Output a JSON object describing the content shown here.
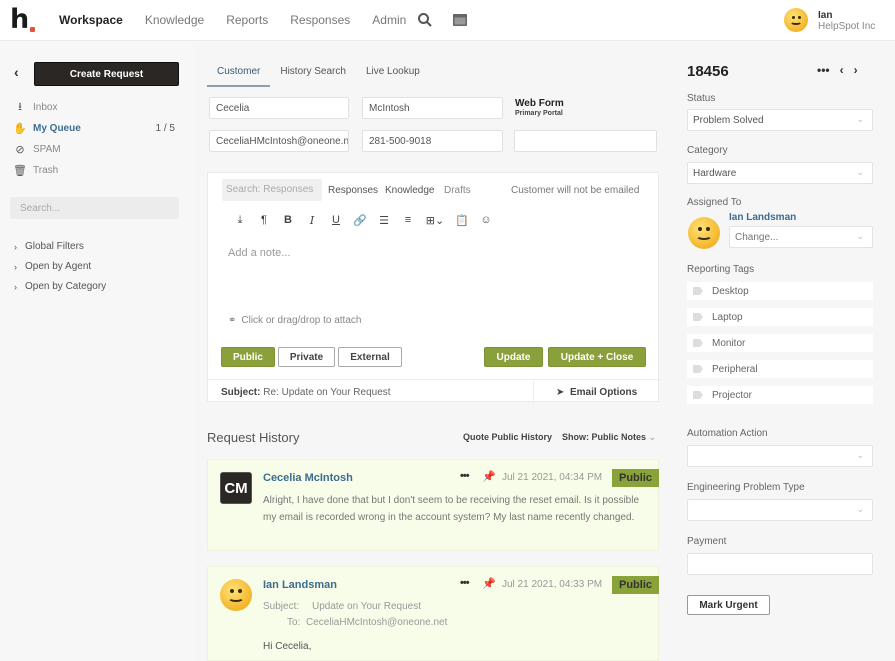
{
  "topbar": {
    "logo": "h",
    "nav": [
      "Workspace",
      "Knowledge",
      "Reports",
      "Responses",
      "Admin"
    ],
    "active_nav": "Workspace",
    "icons": [
      "search-icon",
      "window-icon"
    ],
    "user": {
      "name": "Ian",
      "org": "HelpSpot Inc"
    }
  },
  "sidebar": {
    "create_label": "Create Request",
    "items": [
      {
        "label": "Inbox",
        "icon": "inbox-icon",
        "count": ""
      },
      {
        "label": "My Queue",
        "icon": "hand-icon",
        "count": "1 / 5"
      },
      {
        "label": "SPAM",
        "icon": "ban-icon",
        "count": ""
      },
      {
        "label": "Trash",
        "icon": "trash-icon",
        "count": ""
      }
    ],
    "search_placeholder": "Search...",
    "groups": [
      "Global Filters",
      "Open by Agent",
      "Open by Category"
    ]
  },
  "customer": {
    "tabs": [
      "Customer",
      "History Search",
      "Live Lookup"
    ],
    "first_name": "Cecelia",
    "last_name": "McIntosh",
    "email": "CeceliaHMcIntosh@oneone.net",
    "phone": "281-500-9018",
    "source_title": "Web Form",
    "source_sub": "Primary Portal"
  },
  "editor": {
    "search_placeholder": "Search: Responses",
    "links": [
      "Responses",
      "Knowledge",
      "Drafts"
    ],
    "notice": "Customer will not be emailed",
    "toolbar": [
      "download",
      "paragraph",
      "B",
      "I",
      "U",
      "link",
      "bullet-list",
      "number-list",
      "table",
      "paste",
      "emoji"
    ],
    "placeholder": "Add a note...",
    "attach_label": "Click or drag/drop to attach",
    "visibility": [
      "Public",
      "Private",
      "External"
    ],
    "update_label": "Update",
    "update_close_label": "Update + Close",
    "subject_label": "Subject:",
    "subject_value": "Re: Update on Your Request",
    "email_options_label": "Email Options"
  },
  "history": {
    "title": "Request History",
    "quote_label": "Quote Public History",
    "show_label": "Show: Public Notes",
    "notes": [
      {
        "initials": "CM",
        "author": "Cecelia McIntosh",
        "date": "Jul 21 2021, 04:34 PM",
        "badge": "Public",
        "body": "Alright, I have done that but I don't seem to be receiving the reset email. Is it possible my email is recorded wrong in the account system? My last name recently changed."
      },
      {
        "author": "Ian Landsman",
        "date": "Jul 21 2021, 04:33 PM",
        "badge": "Public",
        "subject_label": "Subject:",
        "subject": "Update on Your Request",
        "to_label": "To:",
        "to": "CeceliaHMcIntosh@oneone.net",
        "greeting": "Hi Cecelia,"
      }
    ]
  },
  "details": {
    "request_id": "18456",
    "status_label": "Status",
    "status_value": "Problem Solved",
    "category_label": "Category",
    "category_value": "Hardware",
    "assigned_label": "Assigned To",
    "assignee": "Ian Landsman",
    "change_placeholder": "Change...",
    "tags_label": "Reporting Tags",
    "tags": [
      "Desktop",
      "Laptop",
      "Monitor",
      "Peripheral",
      "Projector"
    ],
    "automation_label": "Automation Action",
    "engineering_label": "Engineering Problem Type",
    "payment_label": "Payment",
    "mark_urgent_label": "Mark Urgent"
  },
  "colors": {
    "accent_green": "#89a03b",
    "link_blue": "#3c6c8f",
    "dark_button": "#2b2724",
    "note_bg": "#f7fde8"
  }
}
